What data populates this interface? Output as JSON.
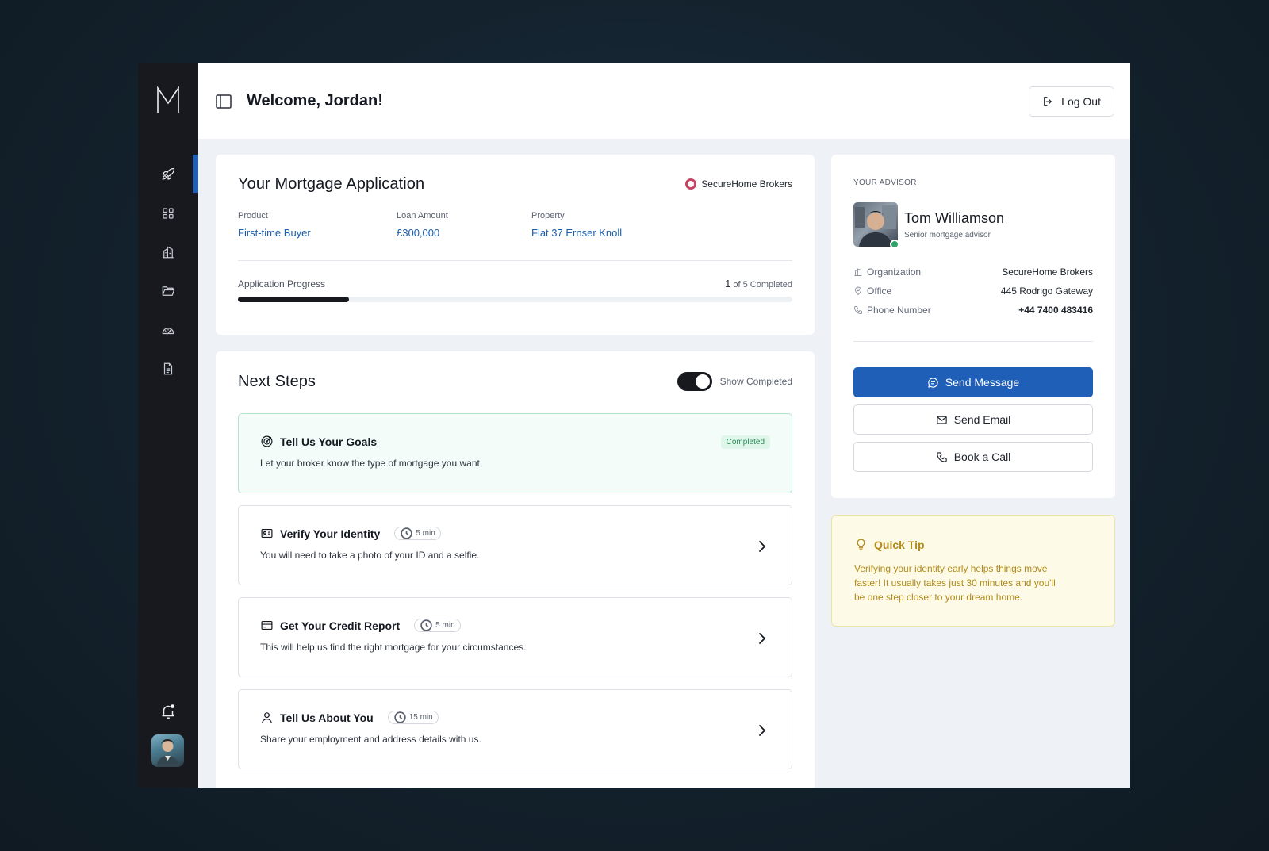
{
  "header": {
    "title": "Welcome, Jordan!",
    "logout_label": "Log Out"
  },
  "sidebar": {
    "logo": "M",
    "items": [
      {
        "name": "rocket-icon",
        "active": true
      },
      {
        "name": "grid-icon",
        "active": false
      },
      {
        "name": "building-icon",
        "active": false
      },
      {
        "name": "folder-icon",
        "active": false
      },
      {
        "name": "gauge-icon",
        "active": false
      },
      {
        "name": "document-icon",
        "active": false
      }
    ]
  },
  "application": {
    "title": "Your Mortgage Application",
    "broker": "SecureHome Brokers",
    "product_label": "Product",
    "product_value": "First-time Buyer",
    "loan_label": "Loan Amount",
    "loan_value": "£300,000",
    "property_label": "Property",
    "property_value": "Flat 37 Ernser Knoll",
    "progress_label": "Application Progress",
    "progress_done": "1",
    "progress_suffix": " of 5 Completed",
    "progress_fraction": 0.2
  },
  "steps": {
    "title": "Next Steps",
    "toggle_label": "Show Completed",
    "toggle_on": true,
    "items": [
      {
        "title": "Tell Us Your Goals",
        "desc": "Let your broker know  the type of mortgage you want.",
        "badge": "Completed",
        "icon": "target-icon"
      },
      {
        "title": "Verify Your Identity",
        "time": "5 min",
        "desc": "You will need to take a photo of your ID and a selfie.",
        "icon": "id-card-icon"
      },
      {
        "title": "Get Your Credit Report",
        "time": "5 min",
        "desc": "This will help us find the right mortgage for your circumstances.",
        "icon": "credit-card-icon"
      },
      {
        "title": "Tell Us About You",
        "time": "15 min",
        "desc": "Share your employment and address details with us.",
        "icon": "user-icon"
      }
    ]
  },
  "advisor": {
    "eyebrow": "YOUR ADVISOR",
    "name": "Tom Williamson",
    "role": "Senior mortgage advisor",
    "org_label": "Organization",
    "org_value": "SecureHome Brokers",
    "office_label": "Office",
    "office_value": "445 Rodrigo Gateway",
    "phone_label": "Phone Number",
    "phone_value": "+44 7400 483416",
    "message_label": "Send Message",
    "email_label": "Send Email",
    "call_label": "Book a Call"
  },
  "tip": {
    "title": "Quick Tip",
    "text": "Verifying your identity early helps things move faster! It usually takes just 30 minutes and you'll be one step closer to your dream home."
  },
  "colors": {
    "accent": "#1f5fb8",
    "sidebar": "#17191f",
    "tip": "#b08a1a",
    "success": "#2e8b5a"
  }
}
